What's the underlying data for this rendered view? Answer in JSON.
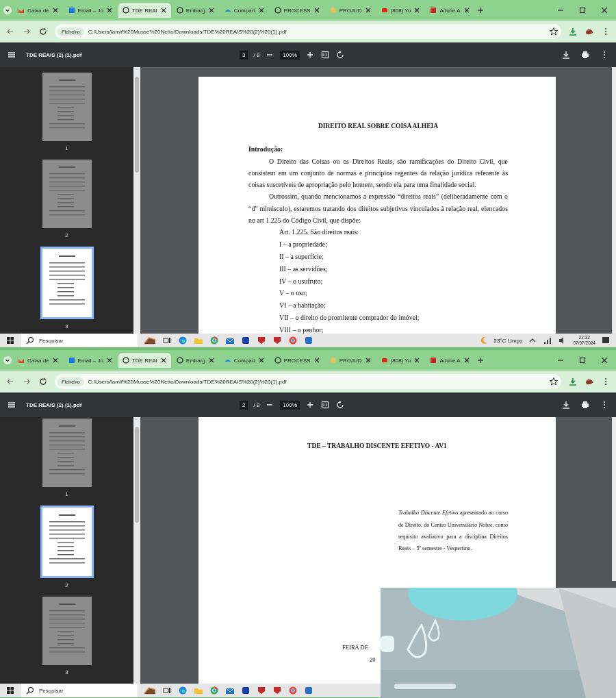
{
  "screens": [
    {
      "tabs": [
        {
          "label": "Caixa de",
          "selected": false
        },
        {
          "label": "Email – Jo",
          "selected": false
        },
        {
          "label": "TDE REAI",
          "selected": true
        },
        {
          "label": "Embarg",
          "selected": false
        },
        {
          "label": "Compart",
          "selected": false
        },
        {
          "label": "PROCESS",
          "selected": false
        },
        {
          "label": "PROJUD",
          "selected": false
        },
        {
          "label": "(808) Yo",
          "selected": false
        },
        {
          "label": "Adobe A",
          "selected": false
        }
      ],
      "address": {
        "chip": "Ficheiro",
        "url": "C:/Users/lamif%20Musse%20Netto/Downloads/TDE%20REAIS%20(2)%20(1).pdf"
      },
      "pdf_toolbar": {
        "title": "TDE REAIS (2) (1).pdf",
        "page": "3",
        "page_count": "/ 8",
        "zoom": "100%"
      },
      "thumbnails": [
        {
          "number": "1",
          "selected": false
        },
        {
          "number": "2",
          "selected": false
        },
        {
          "number": "3",
          "selected": true
        }
      ],
      "page": {
        "kind": "chapter",
        "heading": "DIREITO REAL SOBRE COISA ALHEIA",
        "intro_label": "Introdução:",
        "paragraphs": [
          "O Direito das Coisas ou os Direitos Reais, são ramificações do Direito Civil, que consistem em um conjunto de normas e princípios regentes da relação jurídica referente às coisas suscetíveis de apropriação pelo homem, sendo ela para uma finalidade social.",
          "Outrossim, quando mencionamos a expressão “direitos reais” (deliberadamente com o “d” minúsculo), estaremos tratando dos direitos subjetivos vinculados à relação real, elencados no art 1.225 do Código Civil, que dispõe:"
        ],
        "quote_items": [
          "Art. 1.225. São direitos reais:",
          "I – a propriedade;",
          "II – a superfície;",
          "III – as servidões;",
          "IV – o usufruto;",
          "V – o uso;",
          "VI – a habitação;",
          "VII – o direito do promitente comprador do imóvel;",
          "VIII – o penhor;"
        ]
      },
      "taskbar": {
        "search_placeholder": "Pesquisar",
        "weather": "23°C  Limpo",
        "time": "22:32",
        "date": "07/07/2024"
      }
    },
    {
      "tabs": [
        {
          "label": "Caixa de",
          "selected": false
        },
        {
          "label": "Email – Jo",
          "selected": false
        },
        {
          "label": "TDE REAI",
          "selected": true
        },
        {
          "label": "Embarg",
          "selected": false
        },
        {
          "label": "Compart",
          "selected": false
        },
        {
          "label": "PROCESS",
          "selected": false
        },
        {
          "label": "PROJUD",
          "selected": false
        },
        {
          "label": "(808) Yo",
          "selected": false
        },
        {
          "label": "Adobe A",
          "selected": false
        }
      ],
      "address": {
        "chip": "Ficheiro",
        "url": "C:/Users/lamif%20Musse%20Netto/Downloads/TDE%20REAIS%20(2)%20(1).pdf"
      },
      "pdf_toolbar": {
        "title": "TDE REAIS (2) (1).pdf",
        "page": "2",
        "page_count": "/ 8",
        "zoom": "100%"
      },
      "thumbnails": [
        {
          "number": "1",
          "selected": false
        },
        {
          "number": "2",
          "selected": true
        },
        {
          "number": "3",
          "selected": false
        }
      ],
      "page": {
        "kind": "cover",
        "heading": "TDE – TRABALHO DISCENTE EFETIVO - AV1",
        "abstract": "*Trabalho Discente Efetivo* apresentado ao curso de Direito, do Centro Universitário Nobre, como requisito avaliativo para a disciplina Direitos Reais – 5º semestre - Vespertino.",
        "footer_lines": [
          "FEIRA DE",
          "20"
        ]
      },
      "taskbar": {
        "search_placeholder": "Pesquisar"
      }
    }
  ]
}
